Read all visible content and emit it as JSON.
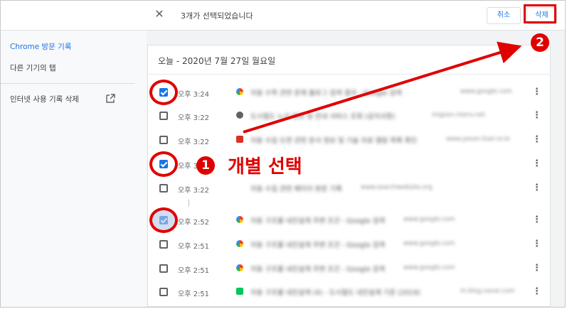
{
  "topbar": {
    "close_glyph": "✕",
    "selection_text": "3개가 선택되었습니다",
    "cancel_label": "취소",
    "delete_label": "삭제"
  },
  "sidebar": {
    "items": [
      {
        "label": "Chrome 방문 기록",
        "active": true
      },
      {
        "label": "다른 기기의 탭",
        "active": false
      },
      {
        "label": "인터넷 사용 기록 삭제",
        "active": false,
        "icon": "external-link-icon"
      }
    ]
  },
  "main": {
    "date_heading": "오늘 - 2020년 7월 27일 월요일",
    "rows": [
      {
        "checked": true,
        "time": "오후 3:24",
        "favicon": "google-icon",
        "title": "자동 수학 관련 문제 블로그 검색 결과 - Google 검색",
        "url": "www.google.com"
      },
      {
        "checked": false,
        "time": "오후 3:22",
        "favicon": "site-icon",
        "title": "도시철도 노선 정보 및 안내 서비스 조회 (공지사항)",
        "url": "imgson.riseru.net"
      },
      {
        "checked": false,
        "time": "오후 3:22",
        "favicon": "site-icon",
        "title": "자동 수집 도면 관련 문서 정보 및 기술 자료 열람 목록 확인",
        "url": "www.yeson.kiair.re.kr"
      },
      {
        "checked": true,
        "time": "오후 3:22",
        "favicon": "site-icon",
        "title": "",
        "url": ""
      },
      {
        "checked": false,
        "time": "오후 3:22",
        "favicon": "site-icon",
        "title": "자동 수집 관련 페이지 방문 기록",
        "url": "www.searchwebsite.org"
      },
      {
        "checked": true,
        "time": "오후 2:52",
        "favicon": "google-icon",
        "title": "자동 구조물 내진설계 주변 조건 - Google 검색",
        "url": "www.google.com"
      },
      {
        "checked": false,
        "time": "오후 2:51",
        "favicon": "google-icon",
        "title": "자동 구조물 내진설계 주변 조건 - Google 검색",
        "url": "www.google.com"
      },
      {
        "checked": false,
        "time": "오후 2:51",
        "favicon": "google-icon",
        "title": "자동 구조물 내진설계 주변 조건 - Google 검색",
        "url": "www.google.com"
      },
      {
        "checked": false,
        "time": "오후 2:51",
        "favicon": "naver-blog-icon",
        "title": "자동 구조물 내진설계 (4) - 도시철도 내진설계 기준 (2019)",
        "url": "m.blog.naver.com"
      }
    ],
    "kebab_glyph": "⋮"
  },
  "annotations": {
    "step1_number": "1",
    "step1_text": "개별 선택",
    "step2_number": "2",
    "color": "#e00000"
  },
  "colors": {
    "accent": "#1a73e8",
    "annotation": "#e00000"
  }
}
